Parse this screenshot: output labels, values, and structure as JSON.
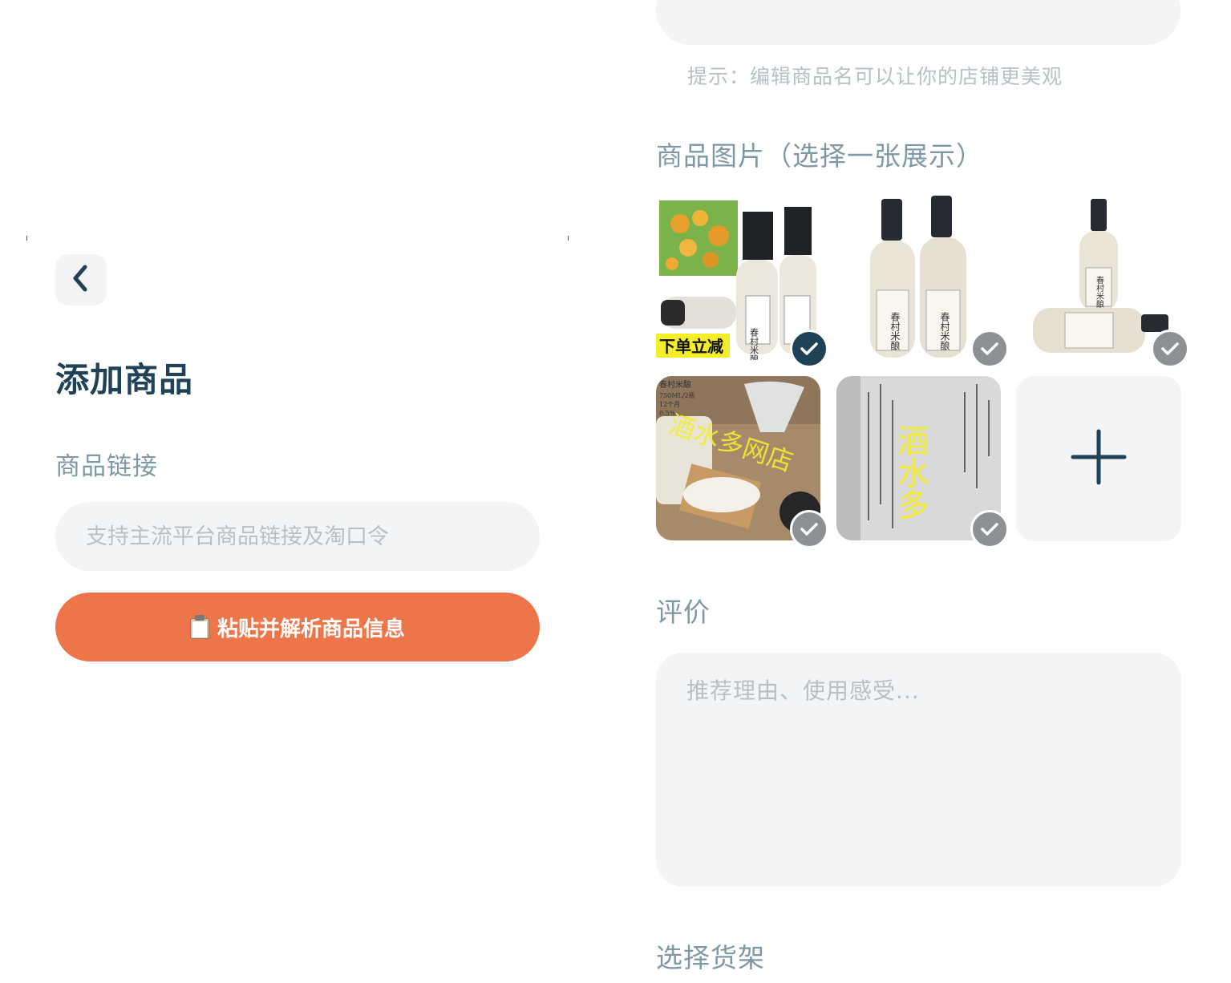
{
  "left": {
    "back_icon": "chevron-left-icon",
    "title": "添加商品",
    "link_label": "商品链接",
    "link_placeholder": "支持主流平台商品链接及淘口令",
    "parse_button": "粘贴并解析商品信息",
    "parse_button_icon": "clipboard-icon"
  },
  "right": {
    "hint": "提示：编辑商品名可以让你的店铺更美观",
    "images_label": "商品图片（选择一张展示）",
    "images": [
      {
        "selected": true,
        "overlay_text": "下单立减",
        "label_text": "春村米酿"
      },
      {
        "selected": false,
        "label_text": "春村米酿"
      },
      {
        "selected": false,
        "label_text": "春村米酿"
      },
      {
        "selected": false,
        "overlay_text": "酒水多网店",
        "corner_text": "春村米酿",
        "corner_lines": [
          "750ML/2瓶",
          "12个月",
          "0.5%"
        ]
      },
      {
        "selected": false,
        "overlay_text": "酒水多"
      }
    ],
    "add_icon": "plus-icon",
    "review_label": "评价",
    "review_placeholder": "推荐理由、使用感受...",
    "shelf_label": "选择货架"
  },
  "colors": {
    "accent": "#ec7549",
    "primary_dark": "#1f4257",
    "label": "#7f98a6",
    "field_bg": "#f3f4f6",
    "placeholder": "#b6c0c6",
    "check_off": "#8e9194"
  }
}
